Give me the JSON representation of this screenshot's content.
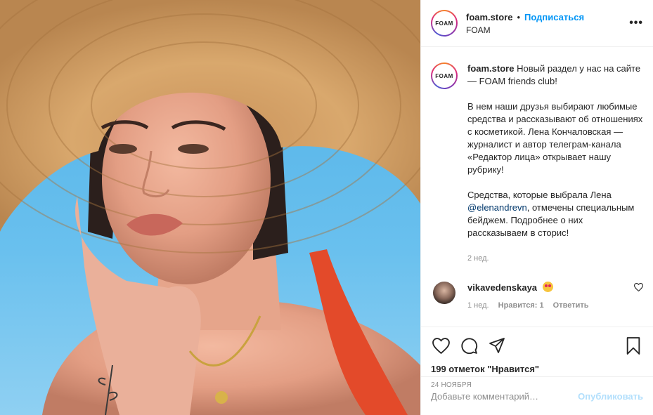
{
  "post": {
    "photo_alt": "",
    "header": {
      "avatar_text": "FOAM",
      "username": "foam.store",
      "dot": "•",
      "follow": "Подписаться",
      "location": "FOAM",
      "more": "•••"
    },
    "caption": {
      "avatar_text": "FOAM",
      "username": "foam.store",
      "line1": " Новый раздел у нас на сайте — FOAM friends club!",
      "para2": "В нем наши друзья выбирают любимые средства и рассказывают об отношениях с косметикой. Лена Кончаловская — журналист и автор телеграм-канала «Редактор лица» открывает нашу рубрику!",
      "para3_a": "Средства, которые выбрала Лена ",
      "para3_mention": "@elenandrevn",
      "para3_b": ", отмечены специальным бейджем. Подробнее о них рассказываем в сторис!",
      "ago": "2 нед."
    },
    "comment": {
      "username": "vikavedenskaya",
      "emoji_icon": "heart-eyes-emoji",
      "time": "1 нед.",
      "likes": "Нравится: 1",
      "reply": "Ответить"
    },
    "actions": {
      "icons": [
        "heart-icon",
        "comment-icon",
        "share-icon",
        "bookmark-icon"
      ],
      "likes": "199 отметок \"Нравится\"",
      "date": "24 НОЯБРЯ"
    },
    "add_comment": {
      "placeholder": "Добавьте комментарий…",
      "publish": "Опубликовать"
    }
  },
  "colors": {
    "accent": "#0095f6",
    "publish_disabled": "#b2dffc",
    "muted": "#8e8e8e"
  }
}
